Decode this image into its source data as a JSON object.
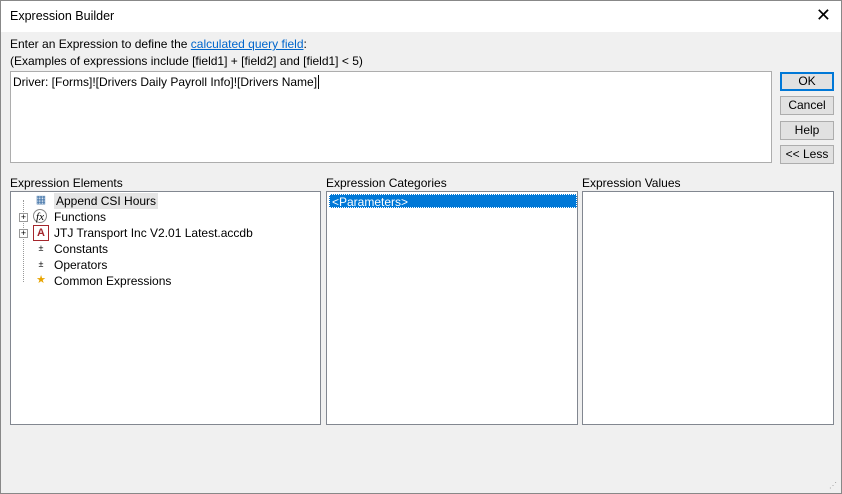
{
  "window": {
    "title": "Expression Builder"
  },
  "intro": {
    "prefix": "Enter an Expression to define the ",
    "link": "calculated query field",
    "suffix": ":",
    "examples": "(Examples of expressions include [field1] + [field2] and [field1] < 5)"
  },
  "expression": "Driver: [Forms]![Drivers Daily Payroll Info]![Drivers Name]",
  "buttons": {
    "ok": "OK",
    "cancel": "Cancel",
    "help": "Help",
    "less": "<< Less"
  },
  "panels": {
    "elements": "Expression Elements",
    "categories": "Expression Categories",
    "values": "Expression Values"
  },
  "elements": [
    {
      "label": "Append CSI Hours",
      "icon": "form-icon"
    },
    {
      "label": "Functions",
      "icon": "function-icon"
    },
    {
      "label": "JTJ Transport Inc V2.01 Latest.accdb",
      "icon": "database-icon"
    },
    {
      "label": "Constants",
      "icon": "constants-icon"
    },
    {
      "label": "Operators",
      "icon": "operators-icon"
    },
    {
      "label": "Common Expressions",
      "icon": "common-expressions-icon"
    }
  ],
  "categories": [
    "<Parameters>"
  ]
}
